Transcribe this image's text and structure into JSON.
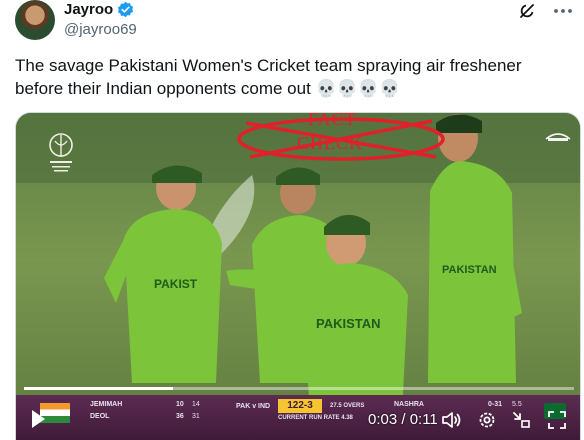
{
  "author": {
    "display_name": "Jayroo",
    "handle": "@jayroo69"
  },
  "tweet": {
    "text_line1": "The savage Pakistani Women's Cricket team spraying air freshener",
    "text_line2": "before their Indian opponents come out 💀💀💀💀"
  },
  "media": {
    "stamp_line1": "FACT",
    "stamp_line2": "CHECK",
    "jersey_text": "PAKISTAN",
    "scoreboard": {
      "batter1_name": "JEMIMAH",
      "batter1_runs": "10",
      "batter1_balls": "14",
      "batter2_name": "DEOL",
      "batter2_runs": "36",
      "batter2_balls": "31",
      "teams": "PAK v IND",
      "score": "122-3",
      "overs": "27.5 OVERS",
      "run_rate": "CURRENT RUN RATE 4.38",
      "bowler_name": "NASHRA",
      "bowler_figures": "0-31",
      "bowler_overs": "5.5"
    },
    "time_display": "0:03 / 0:11",
    "progress": 0.27
  },
  "colors": {
    "verified": "#1d9bf0",
    "jersey": "#7cc43a",
    "stamp": "#e0202a",
    "scoreboard": "#5c2b52"
  },
  "icons": {
    "verified": "verified-badge-icon",
    "grok": "grok-icon",
    "more": "more-icon",
    "play": "play-icon",
    "volume": "volume-icon",
    "settings": "settings-icon",
    "fullscreen_exit": "minimize-icon",
    "fullscreen": "fullscreen-icon"
  }
}
